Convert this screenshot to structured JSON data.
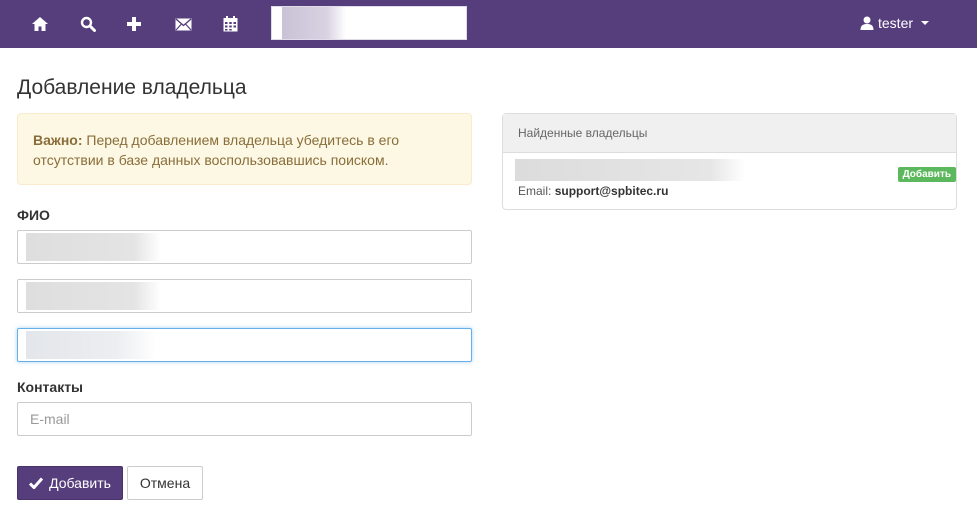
{
  "navbar": {
    "icons": [
      "home-icon",
      "search-icon",
      "plus-icon",
      "envelope-icon",
      "calendar-icon"
    ],
    "user": "tester",
    "background": "#563d7c"
  },
  "page": {
    "title": "Добавление владельца"
  },
  "alert": {
    "strong": "Важно:",
    "text": " Перед добавлением владельца убедитесь в его отсутствии в базе данных воспользовавшись поиском."
  },
  "form": {
    "fio_label": "ФИО",
    "contacts_label": "Контакты",
    "email_placeholder": "E-mail",
    "submit_label": "Добавить",
    "cancel_label": "Отмена"
  },
  "found": {
    "heading": "Найденные владельцы",
    "email_label": "Email:",
    "email_value": "support@spbitec.ru",
    "add_label": "Добавить"
  }
}
